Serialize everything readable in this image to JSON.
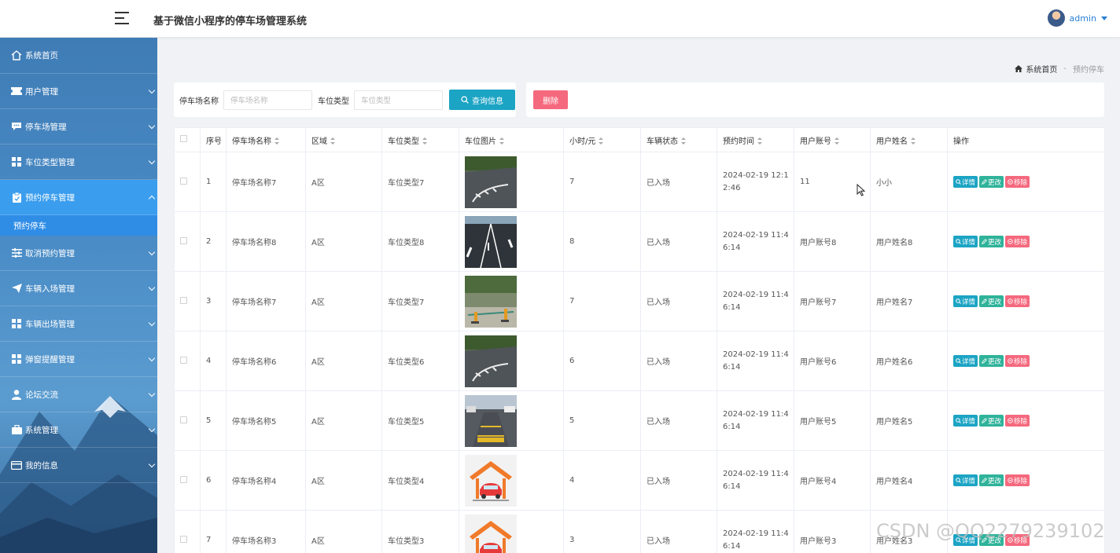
{
  "header": {
    "title": "基于微信小程序的停车场管理系统",
    "username": "admin"
  },
  "sidebar": {
    "items": [
      {
        "label": "系统首页",
        "icon": "home-icon"
      },
      {
        "label": "用户管理",
        "icon": "ticket-icon"
      },
      {
        "label": "停车场管理",
        "icon": "chat-icon"
      },
      {
        "label": "车位类型管理",
        "icon": "grid-icon"
      },
      {
        "label": "预约停车管理",
        "icon": "clipboard-icon",
        "active": true
      },
      {
        "label": "取消预约管理",
        "icon": "sliders-icon"
      },
      {
        "label": "车辆入场管理",
        "icon": "send-icon"
      },
      {
        "label": "车辆出场管理",
        "icon": "grid-icon"
      },
      {
        "label": "弹窗提醒管理",
        "icon": "grid-icon"
      },
      {
        "label": "论坛交流",
        "icon": "user-icon"
      },
      {
        "label": "系统管理",
        "icon": "briefcase-icon"
      },
      {
        "label": "我的信息",
        "icon": "card-icon"
      }
    ],
    "sub_item": "预约停车"
  },
  "breadcrumb": {
    "home": "系统首页",
    "separator": "-",
    "current": "预约停车"
  },
  "search": {
    "lot_label": "停车场名称",
    "lot_placeholder": "停车场名称",
    "type_label": "车位类型",
    "type_placeholder": "车位类型",
    "button": "查询信息"
  },
  "actions": {
    "delete": "删除"
  },
  "table": {
    "columns": [
      "序号",
      "停车场名称",
      "区域",
      "车位类型",
      "车位图片",
      "小时/元",
      "车辆状态",
      "预约时间",
      "用户账号",
      "用户姓名",
      "操作"
    ],
    "op_labels": {
      "detail": "详情",
      "edit": "更改",
      "remove": "移除"
    },
    "rows": [
      {
        "no": "1",
        "lot": "停车场名称7",
        "area": "A区",
        "type": "车位类型7",
        "image": "parking-road",
        "price": "7",
        "status": "已入场",
        "time": "2024-02-19 12:12:46",
        "account": "11",
        "name": "小小"
      },
      {
        "no": "2",
        "lot": "停车场名称8",
        "area": "A区",
        "type": "车位类型8",
        "image": "parking-lanes",
        "price": "8",
        "status": "已入场",
        "time": "2024-02-19 11:46:14",
        "account": "用户账号8",
        "name": "用户姓名8"
      },
      {
        "no": "3",
        "lot": "停车场名称7",
        "area": "A区",
        "type": "车位类型7",
        "image": "parking-lock",
        "price": "7",
        "status": "已入场",
        "time": "2024-02-19 11:46:14",
        "account": "用户账号7",
        "name": "用户姓名7"
      },
      {
        "no": "4",
        "lot": "停车场名称6",
        "area": "A区",
        "type": "车位类型6",
        "image": "parking-road",
        "price": "6",
        "status": "已入场",
        "time": "2024-02-19 11:46:14",
        "account": "用户账号6",
        "name": "用户姓名6"
      },
      {
        "no": "5",
        "lot": "停车场名称5",
        "area": "A区",
        "type": "车位类型5",
        "image": "parking-street",
        "price": "5",
        "status": "已入场",
        "time": "2024-02-19 11:46:14",
        "account": "用户账号5",
        "name": "用户姓名5"
      },
      {
        "no": "6",
        "lot": "停车场名称4",
        "area": "A区",
        "type": "车位类型4",
        "image": "garage-icon",
        "price": "4",
        "status": "已入场",
        "time": "2024-02-19 11:46:14",
        "account": "用户账号4",
        "name": "用户姓名4"
      },
      {
        "no": "7",
        "lot": "停车场名称3",
        "area": "A区",
        "type": "车位类型3",
        "image": "garage-icon",
        "price": "3",
        "status": "已入场",
        "time": "2024-02-19 11:46:14",
        "account": "用户账号3",
        "name": "用户姓名3"
      }
    ]
  },
  "watermark": "CSDN @QQ2279239102",
  "colors": {
    "sidebar": "#4a8cc6",
    "active": "#3a9dee",
    "detail": "#1ca4c4",
    "edit": "#2fb39a",
    "remove": "#f5697e"
  }
}
